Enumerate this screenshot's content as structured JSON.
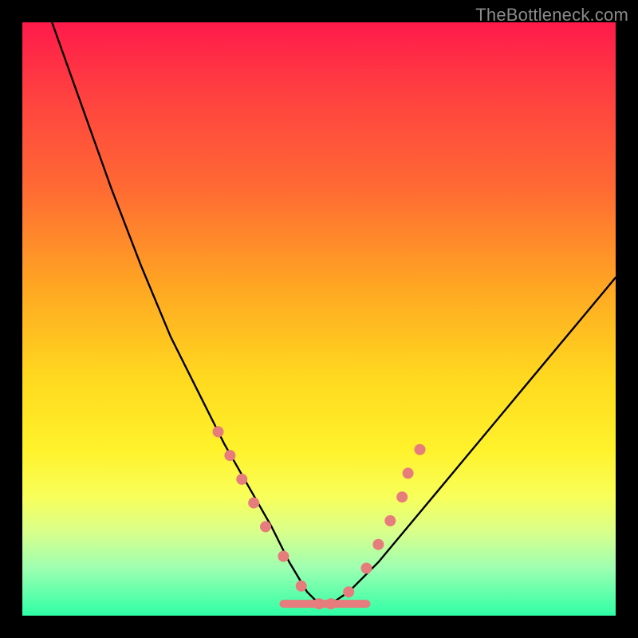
{
  "watermark": "TheBottleneck.com",
  "chart_data": {
    "type": "line",
    "title": "",
    "xlabel": "",
    "ylabel": "",
    "xlim": [
      0,
      100
    ],
    "ylim": [
      0,
      100
    ],
    "legend": false,
    "grid": false,
    "series": [
      {
        "name": "bottleneck-curve",
        "x": [
          5,
          10,
          15,
          20,
          25,
          30,
          34,
          38,
          42,
          45,
          48,
          50,
          52,
          55,
          60,
          65,
          70,
          75,
          80,
          85,
          90,
          95,
          100
        ],
        "y": [
          100,
          86,
          72,
          59,
          47,
          37,
          29,
          22,
          15,
          9,
          4,
          2,
          2,
          4,
          9,
          15,
          21,
          27,
          33,
          39,
          45,
          51,
          57
        ]
      }
    ],
    "markers": {
      "name": "highlight-points",
      "color": "#e77c7c",
      "x": [
        33,
        35,
        37,
        39,
        41,
        44,
        47,
        50,
        52,
        55,
        58,
        60,
        62,
        64,
        65,
        67
      ],
      "y": [
        31,
        27,
        23,
        19,
        15,
        10,
        5,
        2,
        2,
        4,
        8,
        12,
        16,
        20,
        24,
        28
      ]
    },
    "baseline": {
      "name": "flat-segment",
      "color": "#e77c7c",
      "x": [
        44,
        58
      ],
      "y": [
        2,
        2
      ]
    }
  }
}
